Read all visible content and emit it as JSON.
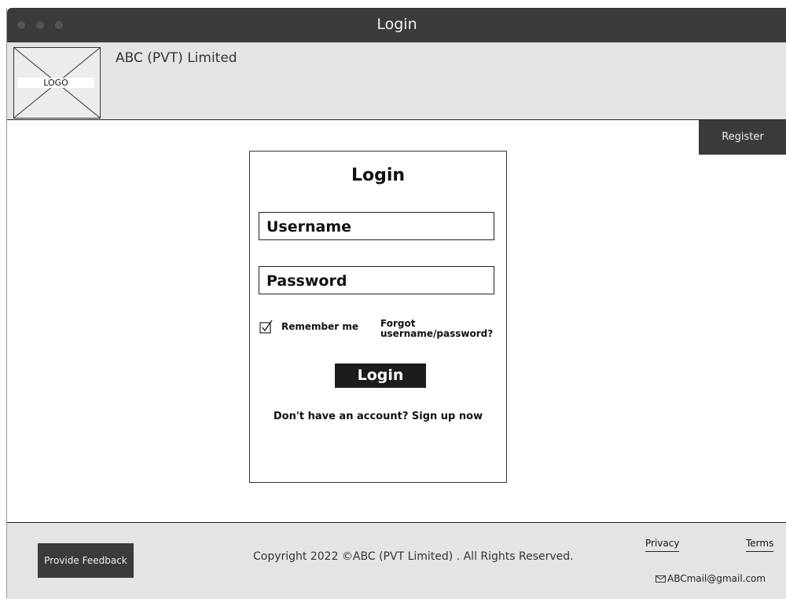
{
  "window": {
    "title": "Login"
  },
  "header": {
    "logo_label": "LOGO",
    "company_name": "ABC (PVT) Limited"
  },
  "nav": {
    "register_label": "Register"
  },
  "login_form": {
    "title": "Login",
    "username_placeholder": "Username",
    "password_placeholder": "Password",
    "remember_label": "Remember me",
    "remember_checked": true,
    "forgot_line1": "Forgot",
    "forgot_line2": "username/password?",
    "submit_label": "Login",
    "signup_text": "Don't have an account? Sign up now"
  },
  "footer": {
    "feedback_label": "Provide Feedback",
    "copyright": "Copyright 2022 ©ABC (PVT Limited) . All Rights Reserved.",
    "privacy_label": "Privacy",
    "terms_label": "Terms",
    "email": "ABCmail@gmail.com",
    "email_icon": "envelope-icon"
  }
}
